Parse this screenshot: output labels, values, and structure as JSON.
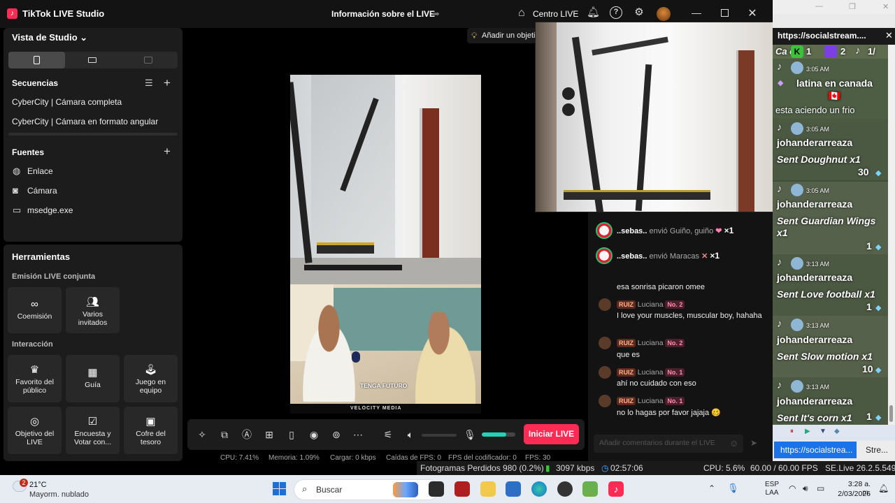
{
  "titlebar": {
    "app_title": "TikTok LIVE Studio",
    "center_title": "Información sobre el LIVE",
    "centro_live": "Centro LIVE"
  },
  "studio_panel": {
    "title": "Vista de Studio",
    "sequences_title": "Secuencias",
    "sequences": [
      "CyberCity | Cámara completa",
      "CyberCity | Cámara en formato angular"
    ],
    "sources_title": "Fuentes",
    "sources": [
      {
        "icon": "globe-icon",
        "label": "Enlace"
      },
      {
        "icon": "camera-icon",
        "label": "Cámara"
      },
      {
        "icon": "window-icon",
        "label": "msedge.exe"
      }
    ]
  },
  "tools_panel": {
    "title": "Herramientas",
    "section_joint": "Emisión LIVE conjunta",
    "joint_tools": [
      {
        "icon": "link-icon",
        "label": "Coemisión"
      },
      {
        "icon": "users-icon",
        "label": "Varios invitados"
      }
    ],
    "section_interaction": "Interacción",
    "interaction_tools": [
      {
        "icon": "audience-favorite-icon",
        "label": "Favorito del público"
      },
      {
        "icon": "guide-icon",
        "label": "Guía"
      },
      {
        "icon": "joystick-icon",
        "label": "Juego en equipo"
      },
      {
        "icon": "target-icon",
        "label": "Objetivo del LIVE"
      },
      {
        "icon": "poll-icon",
        "label": "Encuesta y Votar con..."
      },
      {
        "icon": "treasure-icon",
        "label": "Cofre del tesoro"
      }
    ]
  },
  "preview": {
    "caption": "TENGA FUTURO",
    "watermark": "VELOCITY MEDIA"
  },
  "goal_chip": {
    "label": "Añadir un objeti"
  },
  "toolbar": {
    "start_live": "Iniciar LIVE",
    "volume_level": 0,
    "mic_level": 0.72
  },
  "stats": [
    {
      "label": "CPU:",
      "value": "7.41%"
    },
    {
      "label": "Memoria:",
      "value": "1.09%"
    },
    {
      "label": "Cargar:",
      "value": "0 kbps"
    },
    {
      "label": "Caídas de FPS:",
      "value": "0"
    },
    {
      "label": "FPS del codificador:",
      "value": "0"
    },
    {
      "label": "FPS:",
      "value": "30"
    }
  ],
  "chat": {
    "gifts": [
      {
        "user": "..sebas..",
        "verb": "envió Guiño, guiño",
        "icon": "wink-gift-icon",
        "count": "×1"
      },
      {
        "user": "..sebas..",
        "verb": "envió Maracas",
        "icon": "maracas-gift-icon",
        "count": "×1"
      }
    ],
    "first_message": "esa sonrisa picaron omee",
    "messages": [
      {
        "badge": "RUIZ",
        "name": "Luciana",
        "rank": "No. 2",
        "text": "I love your muscles, muscular boy, hahaha"
      },
      {
        "badge": "RUIZ",
        "name": "Luciana",
        "rank": "No. 2",
        "text": "que es"
      },
      {
        "badge": "RUIZ",
        "name": "Luciana",
        "rank": "No. 1",
        "text": "ahí no cuidado con eso"
      },
      {
        "badge": "RUIZ",
        "name": "Luciana",
        "rank": "No. 1",
        "text": "no lo hagas por favor jajaja 🥴"
      }
    ],
    "input_placeholder": "Añadir comentarios durante el LIVE"
  },
  "right_window": {
    "url": "https://socialstream....",
    "header_counts": [
      "1",
      "2",
      "1/"
    ],
    "header_partial": "Ca    es",
    "feed": [
      {
        "time": "3:05 AM",
        "name": "latina en canada 🇨🇦",
        "message": "esta aciendo un frio",
        "value": ""
      },
      {
        "time": "3:05 AM",
        "name": "johanderarreaza",
        "message": "Sent Doughnut x1",
        "value": "30"
      },
      {
        "time": "3:05 AM",
        "name": "johanderarreaza",
        "message": "Sent Guardian Wings x1",
        "value": "1"
      },
      {
        "time": "3:13 AM",
        "name": "johanderarreaza",
        "message": "Sent Love football x1",
        "value": "1"
      },
      {
        "time": "3:13 AM",
        "name": "johanderarreaza",
        "message": "Sent Slow motion x1",
        "value": "10"
      },
      {
        "time": "3:13 AM",
        "name": "johanderarreaza",
        "message": "Sent It's corn x1",
        "value": "1"
      }
    ],
    "tabs": [
      "https://socialstrea...",
      "Stre..."
    ]
  },
  "status_strip": {
    "dropped": "Fotogramas Perdidos 980 (0.2%)",
    "bitrate": "3097 kbps",
    "uptime": "02:57:06",
    "cpu": "CPU: 5.6%",
    "fps": "60.00 / 60.00 FPS",
    "version": "SE.Live 26.2.5.549"
  },
  "taskbar": {
    "weather_badge": "2",
    "temperature": "21°C",
    "weather_desc": "Mayorm. nublado",
    "search_label": "Buscar",
    "lang_line1": "ESP",
    "lang_line2": "LAA",
    "time": "3:28 a. m.",
    "date": "2/03/2026"
  }
}
